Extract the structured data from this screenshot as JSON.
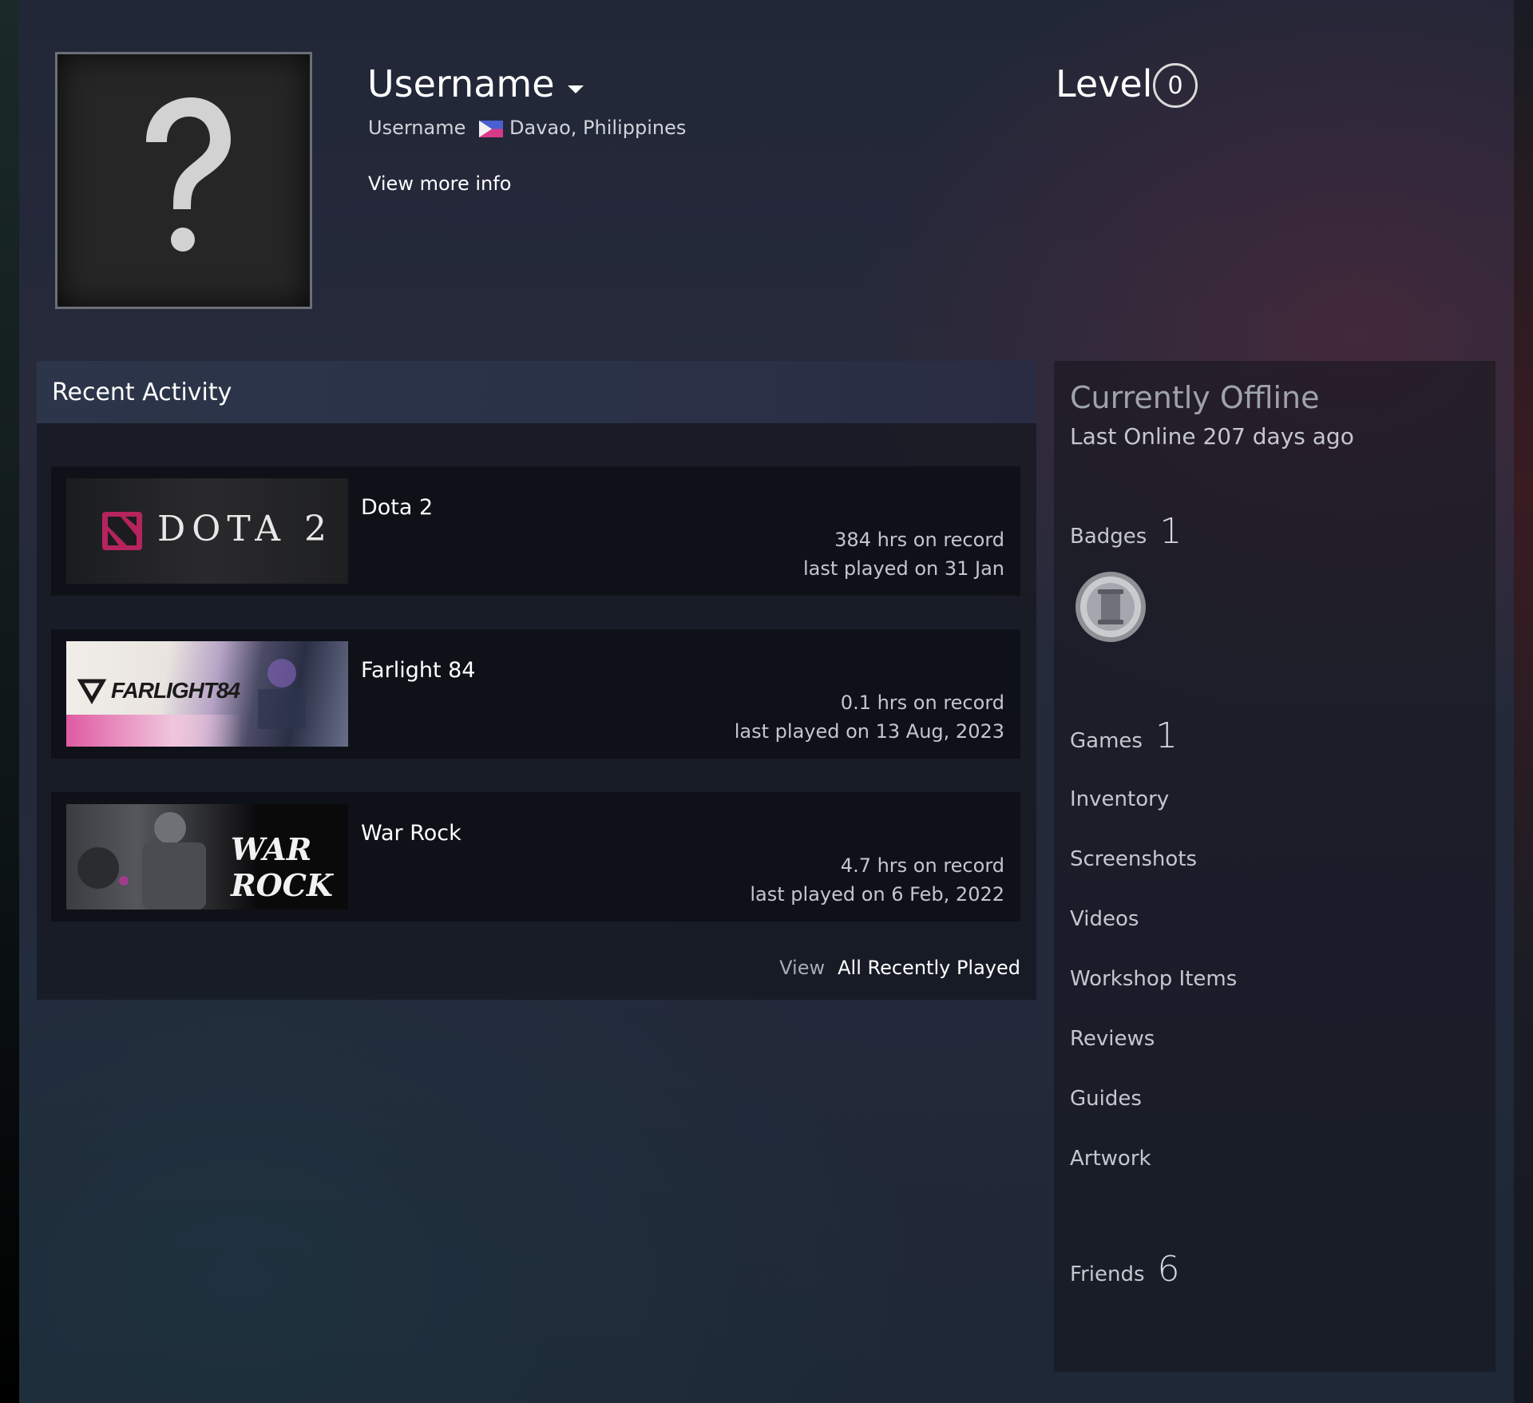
{
  "profile": {
    "persona_name": "Username",
    "real_name": "Username",
    "location": "Davao, Philippines",
    "view_more_info": "View more info",
    "level_label": "Level",
    "level_value": "0"
  },
  "recent_activity": {
    "title": "Recent Activity",
    "games": [
      {
        "name": "Dota 2",
        "hours": "384 hrs on record",
        "last_played": "last played on 31 Jan",
        "logo_text": "DOTA 2"
      },
      {
        "name": "Farlight 84",
        "hours": "0.1 hrs on record",
        "last_played": "last played on 13 Aug, 2023",
        "logo_text": "FARLIGHT84"
      },
      {
        "name": "War Rock",
        "hours": "4.7 hrs on record",
        "last_played": "last played on 6 Feb, 2022",
        "logo_text": "WAR ROCK"
      }
    ],
    "view_label": "View",
    "all_recently_played": "All Recently Played"
  },
  "sidebar": {
    "status": "Currently Offline",
    "last_online": "Last Online 207 days ago",
    "badges": {
      "label": "Badges",
      "count": "1"
    },
    "games": {
      "label": "Games",
      "count": "1"
    },
    "links": [
      "Inventory",
      "Screenshots",
      "Videos",
      "Workshop Items",
      "Reviews",
      "Guides",
      "Artwork"
    ],
    "friends": {
      "label": "Friends",
      "count": "6"
    }
  },
  "colors": {
    "background": "#23293a",
    "panel_header": "#2c3549",
    "game_row": "#0f1118",
    "dota_red": "#b5245e"
  }
}
